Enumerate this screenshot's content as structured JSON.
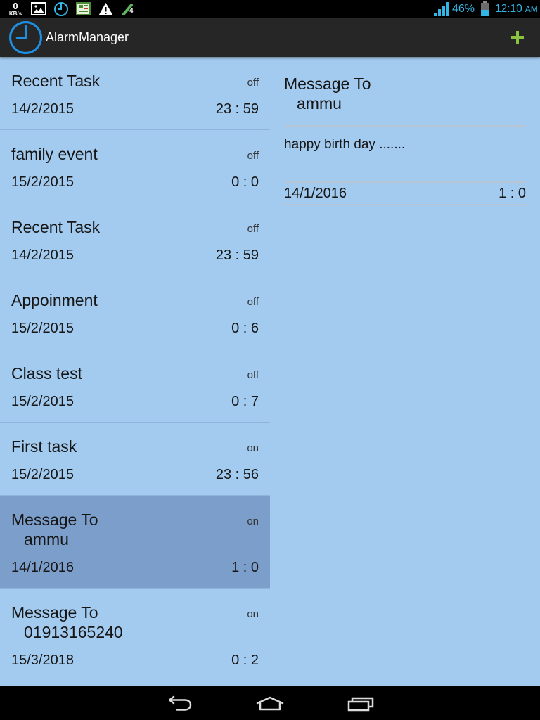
{
  "status_bar": {
    "net_speed_value": "0",
    "net_speed_unit": "KB/s",
    "notification_icons": [
      "gallery-icon",
      "clock-icon",
      "app-notification-icon",
      "warning-icon",
      "call-icon"
    ],
    "call_badge": "4",
    "signal_icon": "signal-icon",
    "signal_strength": 1.0,
    "battery_icon": "battery-icon",
    "battery_percent": "46%",
    "time": "12:10",
    "time_suffix": "AM"
  },
  "action_bar": {
    "app_icon": "alarm-clock-icon",
    "title": "AlarmManager",
    "add_button_icon": "plus-icon"
  },
  "alarms": [
    {
      "title": "Recent Task",
      "status": "off",
      "date": "14/2/2015",
      "time": "23 : 59",
      "selected": false
    },
    {
      "title": "family event",
      "status": "off",
      "date": "15/2/2015",
      "time": "0 : 0",
      "selected": false
    },
    {
      "title": "Recent Task",
      "status": "off",
      "date": "14/2/2015",
      "time": "23 : 59",
      "selected": false
    },
    {
      "title": "Appoinment",
      "status": "off",
      "date": "15/2/2015",
      "time": "0 : 6",
      "selected": false
    },
    {
      "title": "Class test",
      "status": "off",
      "date": "15/2/2015",
      "time": "0 : 7",
      "selected": false
    },
    {
      "title": "First task",
      "status": "on",
      "date": "15/2/2015",
      "time": "23 : 56",
      "selected": false
    },
    {
      "title": "Message To",
      "title_line2": "ammu",
      "status": "on",
      "date": "14/1/2016",
      "time": "1 : 0",
      "selected": true
    },
    {
      "title": "Message To",
      "title_line2": "01913165240",
      "status": "on",
      "date": "15/3/2018",
      "time": "0 : 2",
      "selected": false
    }
  ],
  "detail": {
    "title": "Message To",
    "title_line2": "ammu",
    "message": "happy birth day .......",
    "date": "14/1/2016",
    "time": "1 : 0"
  },
  "nav_bar": {
    "buttons": [
      "back-icon",
      "home-icon",
      "recent-apps-icon"
    ]
  },
  "colors": {
    "status_bar_bg": "#000000",
    "action_bar_bg": "#262626",
    "content_bg": "#a3caef",
    "selected_row_bg": "#7c9ecb",
    "row_divider": "#8fb3da",
    "detail_divider": "#b8c6d4",
    "status_icon_blue": "#33b5e5",
    "app_icon_blue": "#1f8fe2",
    "add_green": "#8ac43f",
    "call_icon_green": "#5cb85c",
    "text_primary": "#161616",
    "text_secondary": "#333333",
    "nav_icon": "#dddddd"
  }
}
